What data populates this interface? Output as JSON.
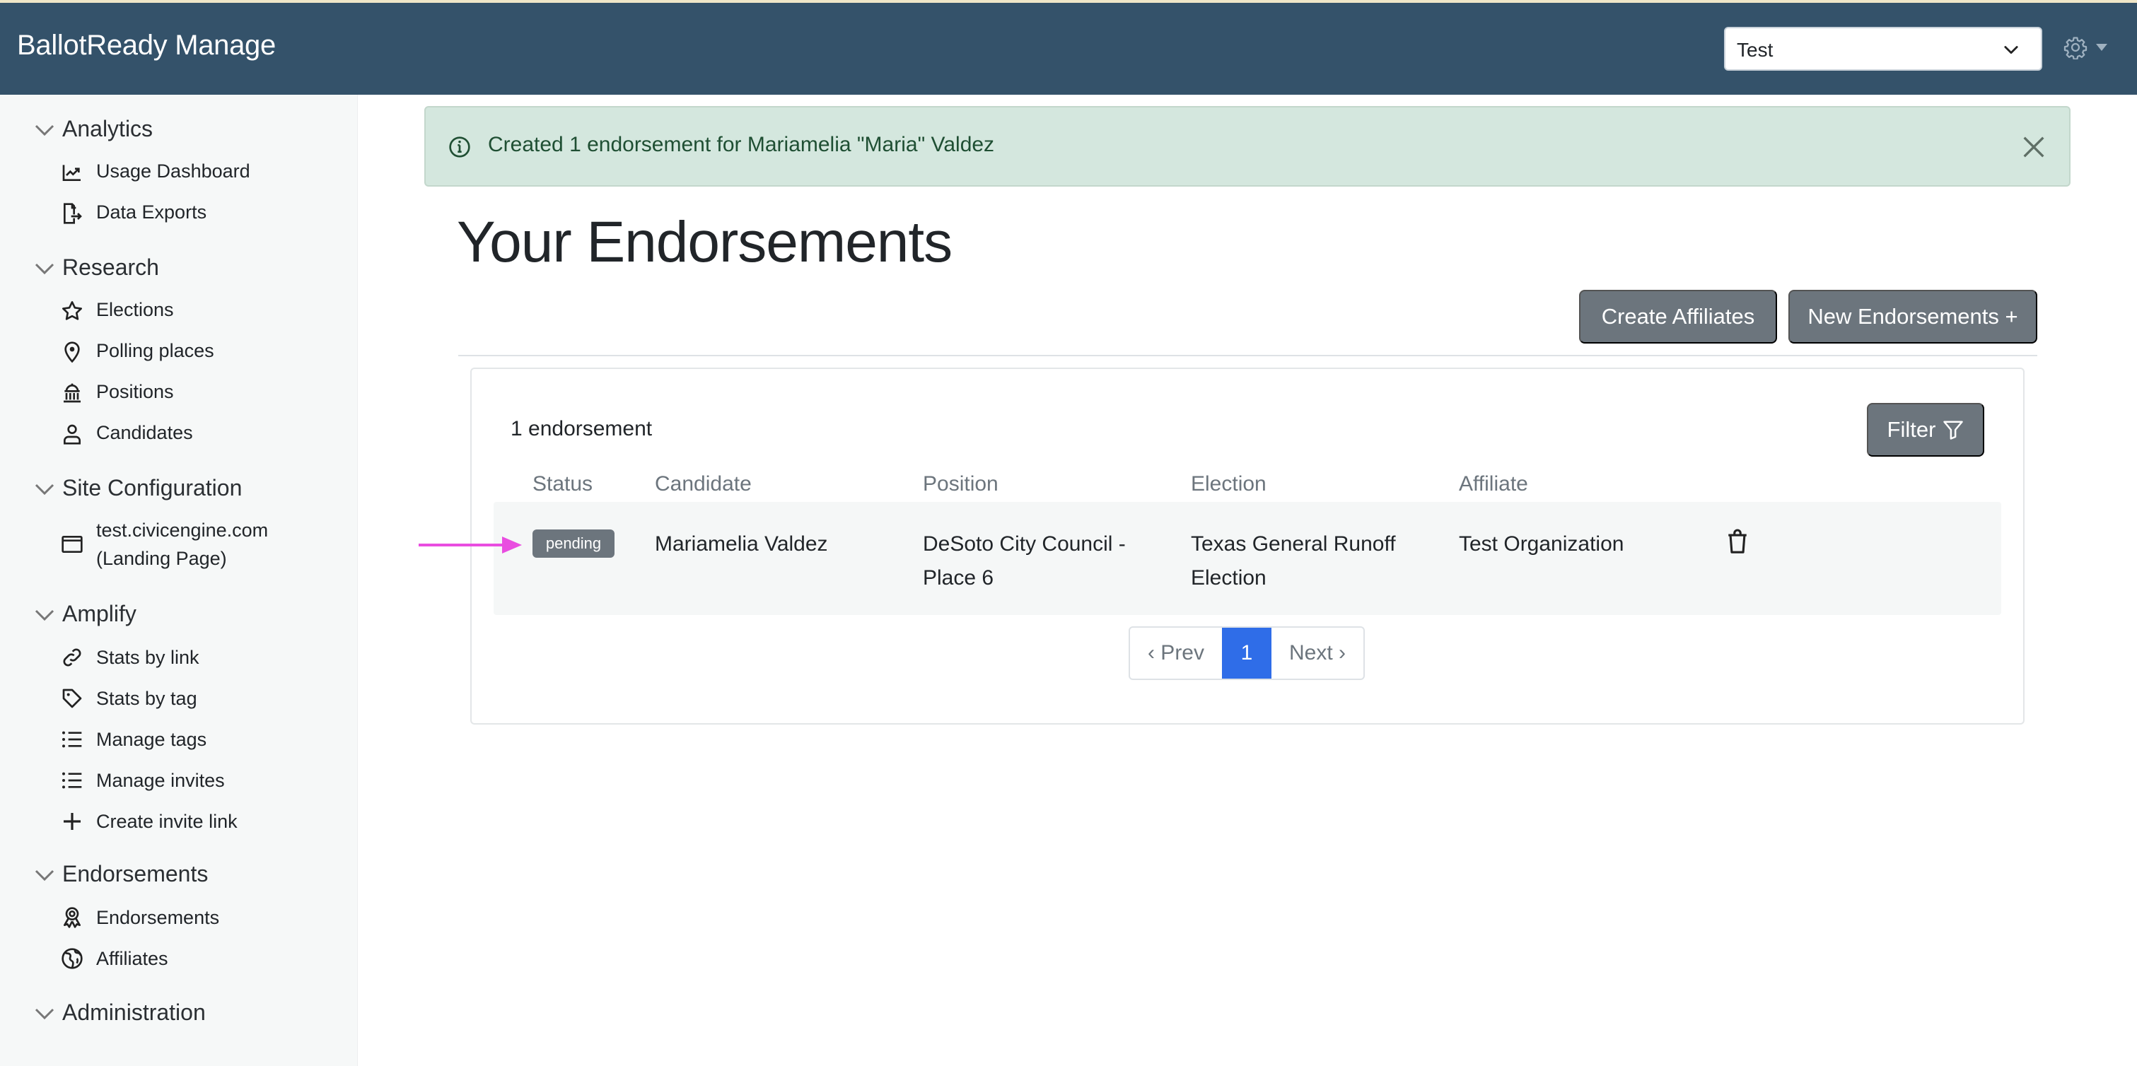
{
  "app": {
    "brand": "BallotReady Manage"
  },
  "header": {
    "org_select_value": "Test"
  },
  "sidebar": {
    "sections": [
      {
        "title": "Analytics",
        "items": [
          {
            "label": "Usage Dashboard",
            "icon": "chart-line-icon"
          },
          {
            "label": "Data Exports",
            "icon": "file-export-icon"
          }
        ]
      },
      {
        "title": "Research",
        "items": [
          {
            "label": "Elections",
            "icon": "star-icon"
          },
          {
            "label": "Polling places",
            "icon": "map-pin-icon"
          },
          {
            "label": "Positions",
            "icon": "capitol-building-icon"
          },
          {
            "label": "Candidates",
            "icon": "person-icon"
          }
        ]
      },
      {
        "title": "Site Configuration",
        "items": [
          {
            "label": "test.civicengine.com",
            "label2": "(Landing Page)",
            "icon": "browser-window-icon"
          }
        ]
      },
      {
        "title": "Amplify",
        "items": [
          {
            "label": "Stats by link",
            "icon": "link-icon"
          },
          {
            "label": "Stats by tag",
            "icon": "tag-icon"
          },
          {
            "label": "Manage tags",
            "icon": "list-icon"
          },
          {
            "label": "Manage invites",
            "icon": "list-icon"
          },
          {
            "label": "Create invite link",
            "icon": "plus-icon"
          }
        ]
      },
      {
        "title": "Endorsements",
        "items": [
          {
            "label": "Endorsements",
            "icon": "award-ribbon-icon"
          },
          {
            "label": "Affiliates",
            "icon": "globe-icon"
          }
        ]
      },
      {
        "title": "Administration",
        "items": []
      }
    ]
  },
  "alert": {
    "message": "Created 1 endorsement for Mariamelia \"Maria\" Valdez",
    "type": "success"
  },
  "main": {
    "title": "Your Endorsements",
    "buttons": {
      "create_affiliates": "Create Affiliates",
      "new_endorsements": "New Endorsements +"
    },
    "count_label": "1 endorsement",
    "filter_label": "Filter",
    "table": {
      "columns": [
        "Status",
        "Candidate",
        "Position",
        "Election",
        "Affiliate"
      ],
      "rows": [
        {
          "status": "pending",
          "candidate": "Mariamelia Valdez",
          "position_line1": "DeSoto City Council -",
          "position_line2": "Place 6",
          "election_line1": "Texas General Runoff",
          "election_line2": "Election",
          "affiliate": "Test Organization"
        }
      ]
    },
    "pagination": {
      "prev": "‹ Prev",
      "current": "1",
      "next": "Next ›"
    }
  },
  "colors": {
    "navbar": "#34526a",
    "alert_bg": "#d4e7de",
    "button_secondary": "#6c757d",
    "page_active": "#2f6de8",
    "annotation_arrow": "#e94de0"
  }
}
